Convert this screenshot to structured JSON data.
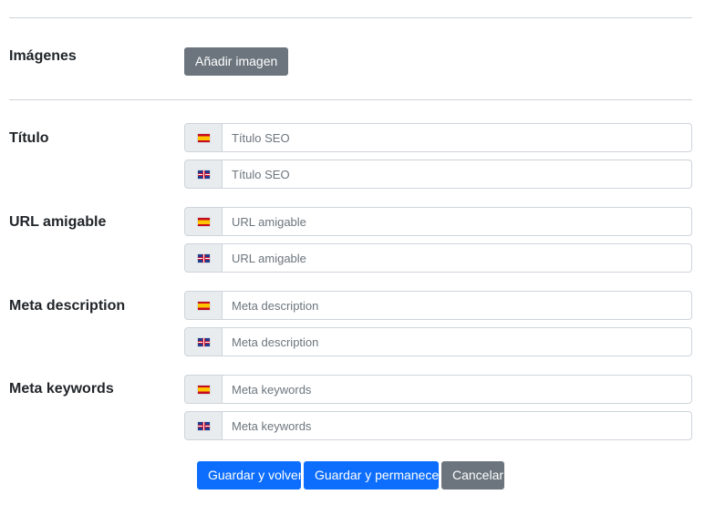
{
  "images": {
    "label": "Imágenes",
    "add_button": "Añadir imagen"
  },
  "languages": [
    {
      "code": "es",
      "icon": "flag-spain-icon"
    },
    {
      "code": "en",
      "icon": "flag-uk-icon"
    }
  ],
  "fields": {
    "title": {
      "label": "Título",
      "es": {
        "value": "",
        "placeholder": "Título SEO"
      },
      "en": {
        "value": "",
        "placeholder": "Título SEO"
      }
    },
    "url": {
      "label": "URL amigable",
      "es": {
        "value": "",
        "placeholder": "URL amigable"
      },
      "en": {
        "value": "",
        "placeholder": "URL amigable"
      }
    },
    "meta_description": {
      "label": "Meta description",
      "es": {
        "value": "",
        "placeholder": "Meta description"
      },
      "en": {
        "value": "",
        "placeholder": "Meta description"
      }
    },
    "meta_keywords": {
      "label": "Meta keywords",
      "es": {
        "value": "",
        "placeholder": "Meta keywords"
      },
      "en": {
        "value": "",
        "placeholder": "Meta keywords"
      }
    }
  },
  "actions": {
    "save_back": "Guardar y volver",
    "save_stay": "Guardar y permanecer",
    "cancel": "Cancelar"
  },
  "colors": {
    "primary": "#0d6efd",
    "secondary": "#6c757d",
    "addon_bg": "#e9ecef",
    "border": "#ced4da"
  }
}
